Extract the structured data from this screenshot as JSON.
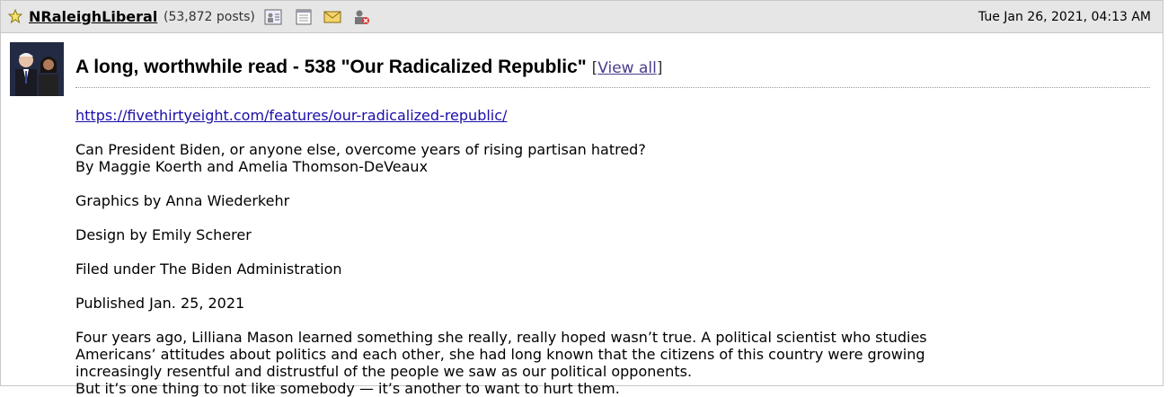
{
  "header": {
    "username": "NRaleighLiberal",
    "post_count": "(53,872 posts)",
    "date": "Tue Jan 26, 2021, 04:13 AM",
    "icons": [
      "star-icon",
      "profile-icon",
      "journal-icon",
      "mail-icon",
      "ignore-icon"
    ]
  },
  "post": {
    "title": "A long, worthwhile read - 538 \"Our Radicalized Republic\"",
    "view_all_prefix": "[",
    "view_all_label": "View all",
    "view_all_suffix": "]",
    "link": "https://fivethirtyeight.com/features/our-radicalized-republic/",
    "subtitle": "Can President Biden, or anyone else, overcome years of rising partisan hatred?",
    "byline": "By Maggie Koerth and Amelia Thomson-DeVeaux",
    "graphics": "Graphics by Anna Wiederkehr",
    "design": "Design by Emily Scherer",
    "filed": "Filed under The Biden Administration",
    "published": "Published Jan. 25, 2021",
    "para1": "Four years ago, Lilliana Mason learned something she really, really hoped wasn’t true. A political scientist who studies Americans’ attitudes about politics and each other, she had long known that the citizens of this country were growing increasingly resentful and distrustful of the people we saw as our political opponents.",
    "para2": "But it’s one thing to not like somebody — it’s another to want to hurt them."
  }
}
